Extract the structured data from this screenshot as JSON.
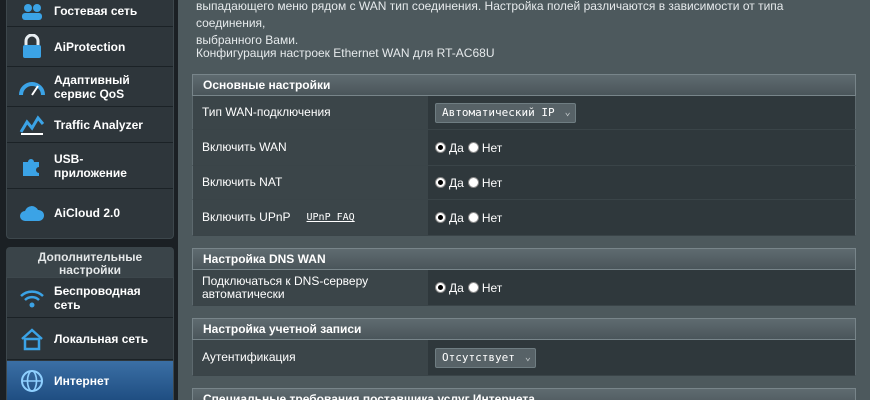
{
  "sidebar": {
    "items": [
      {
        "label": "Гостевая сеть",
        "icon": "guest-network-icon"
      },
      {
        "label": "AiProtection",
        "icon": "lock-icon"
      },
      {
        "label": "Адаптивный сервис QoS",
        "icon": "gauge-icon"
      },
      {
        "label": "Traffic Analyzer",
        "icon": "chart-icon"
      },
      {
        "label": "USB-приложение",
        "icon": "puzzle-icon"
      },
      {
        "label": "AiCloud 2.0",
        "icon": "cloud-icon"
      }
    ],
    "advanced_header": "Дополнительные настройки",
    "advanced_items": [
      {
        "label": "Беспроводная сеть",
        "icon": "wifi-icon"
      },
      {
        "label": "Локальная сеть",
        "icon": "home-icon"
      },
      {
        "label": "Интернет",
        "icon": "globe-icon",
        "active": true
      }
    ]
  },
  "main": {
    "description_line1": "выпадающего меню рядом с WAN тип соединения. Настройка полей различаются в зависимости от типа соединения,",
    "description_line2": "выбранного Вами.",
    "config_title": "Конфигурация настроек Ethernet WAN для RT-AC68U",
    "sections": {
      "basic": {
        "title": "Основные настройки",
        "wan_type_label": "Тип WAN-подключения",
        "wan_type_value": "Автоматический IP",
        "enable_wan_label": "Включить WAN",
        "enable_nat_label": "Включить NAT",
        "enable_upnp_label": "Включить UPnP",
        "upnp_faq": "UPnP FAQ"
      },
      "dns": {
        "title": "Настройка DNS WAN",
        "auto_dns_label": "Подключаться к DNS-серверу автоматически"
      },
      "account": {
        "title": "Настройка учетной записи",
        "auth_label": "Аутентификация",
        "auth_value": "Отсутствует"
      },
      "isp": {
        "title": "Специальные требования поставщика услуг Интернета"
      }
    },
    "radio": {
      "yes": "Да",
      "no": "Нет"
    }
  }
}
